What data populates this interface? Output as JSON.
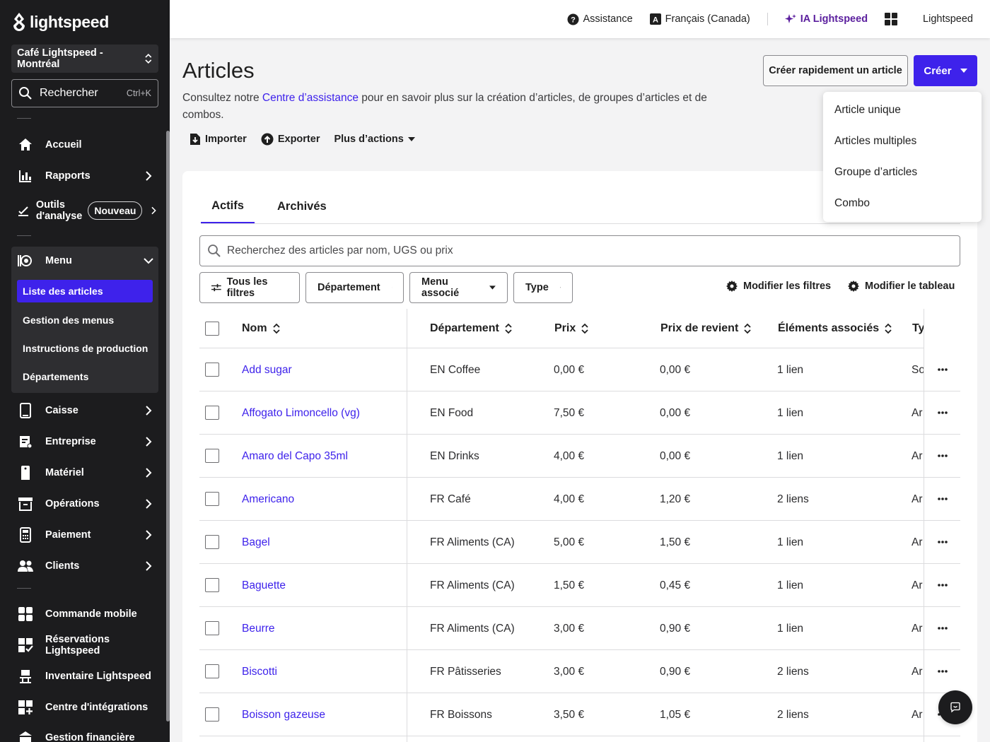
{
  "brand": {
    "logo_text": "lightspeed"
  },
  "venue": {
    "name": "Café Lightspeed - Montréal"
  },
  "sidebar_search": {
    "label": "Rechercher",
    "shortcut": "Ctrl+K"
  },
  "nav": {
    "accueil": "Accueil",
    "rapports": "Rapports",
    "outils_line1": "Outils",
    "outils_line2": "d'analyse",
    "outils_badge": "Nouveau",
    "menu": "Menu",
    "menu_sub": [
      "Liste des articles",
      "Gestion des menus",
      "Instructions de production",
      "Départements"
    ],
    "caisse": "Caisse",
    "entreprise": "Entreprise",
    "materiel": "Matériel",
    "operations": "Opérations",
    "paiement": "Paiement",
    "clients": "Clients",
    "commande_mobile": "Commande mobile",
    "reservations": "Réservations Lightspeed",
    "inventaire": "Inventaire Lightspeed",
    "integrations": "Centre d'intégrations",
    "gestion_financiere": "Gestion financière"
  },
  "topbar": {
    "assistance": "Assistance",
    "language": "Français (Canada)",
    "ai": "IA Lightspeed",
    "account": "Lightspeed"
  },
  "page": {
    "title": "Articles",
    "desc_before": "Consultez notre ",
    "desc_link": "Centre d’assistance",
    "desc_after": " pour en savoir plus sur la création d’articles, de groupes d’articles et de combos.",
    "import": "Importer",
    "export": "Exporter",
    "more_actions": "Plus d’actions",
    "quick_create": "Créer rapidement un article",
    "create": "Créer"
  },
  "create_menu": [
    "Article unique",
    "Articles multiples",
    "Groupe d’articles",
    "Combo"
  ],
  "tabs": {
    "active": "Actifs",
    "archived": "Archivés"
  },
  "search": {
    "placeholder": "Recherchez des articles par nom, UGS ou prix"
  },
  "filters": {
    "all": "Tous les filtres",
    "department": "Département",
    "menu": "Menu associé",
    "type": "Type",
    "edit_filters": "Modifier les filtres",
    "edit_table": "Modifier le tableau"
  },
  "table": {
    "headers": {
      "name": "Nom",
      "department": "Département",
      "price": "Prix",
      "cost": "Prix de revient",
      "linked": "Éléments associés",
      "type": "Ty"
    },
    "rows": [
      {
        "name": "Add sugar",
        "department": "EN Coffee",
        "price": "0,00 €",
        "cost": "0,00 €",
        "linked": "1 lien",
        "type": "So"
      },
      {
        "name": "Affogato Limoncello (vg)",
        "department": "EN Food",
        "price": "7,50 €",
        "cost": "0,00 €",
        "linked": "1 lien",
        "type": "Ar"
      },
      {
        "name": "Amaro del Capo 35ml",
        "department": "EN Drinks",
        "price": "4,00 €",
        "cost": "0,00 €",
        "linked": "1 lien",
        "type": "Ar"
      },
      {
        "name": "Americano",
        "department": "FR Café",
        "price": "4,00 €",
        "cost": "1,20 €",
        "linked": "2 liens",
        "type": "Ar"
      },
      {
        "name": "Bagel",
        "department": "FR Aliments (CA)",
        "price": "5,00 €",
        "cost": "1,50 €",
        "linked": "1 lien",
        "type": "Ar"
      },
      {
        "name": "Baguette",
        "department": "FR Aliments (CA)",
        "price": "1,50 €",
        "cost": "0,45 €",
        "linked": "1 lien",
        "type": "Ar"
      },
      {
        "name": "Beurre",
        "department": "FR Aliments (CA)",
        "price": "3,00 €",
        "cost": "0,90 €",
        "linked": "1 lien",
        "type": "Ar"
      },
      {
        "name": "Biscotti",
        "department": "FR Pâtisseries",
        "price": "3,00 €",
        "cost": "0,90 €",
        "linked": "2 liens",
        "type": "Ar"
      },
      {
        "name": "Boisson gazeuse",
        "department": "FR Boissons",
        "price": "3,50 €",
        "cost": "1,05 €",
        "linked": "2 liens",
        "type": "Ar"
      }
    ]
  },
  "colors": {
    "accent": "#3e22eb",
    "sidebar_bg": "#1c1c1e",
    "ai": "#5b1f9e"
  }
}
